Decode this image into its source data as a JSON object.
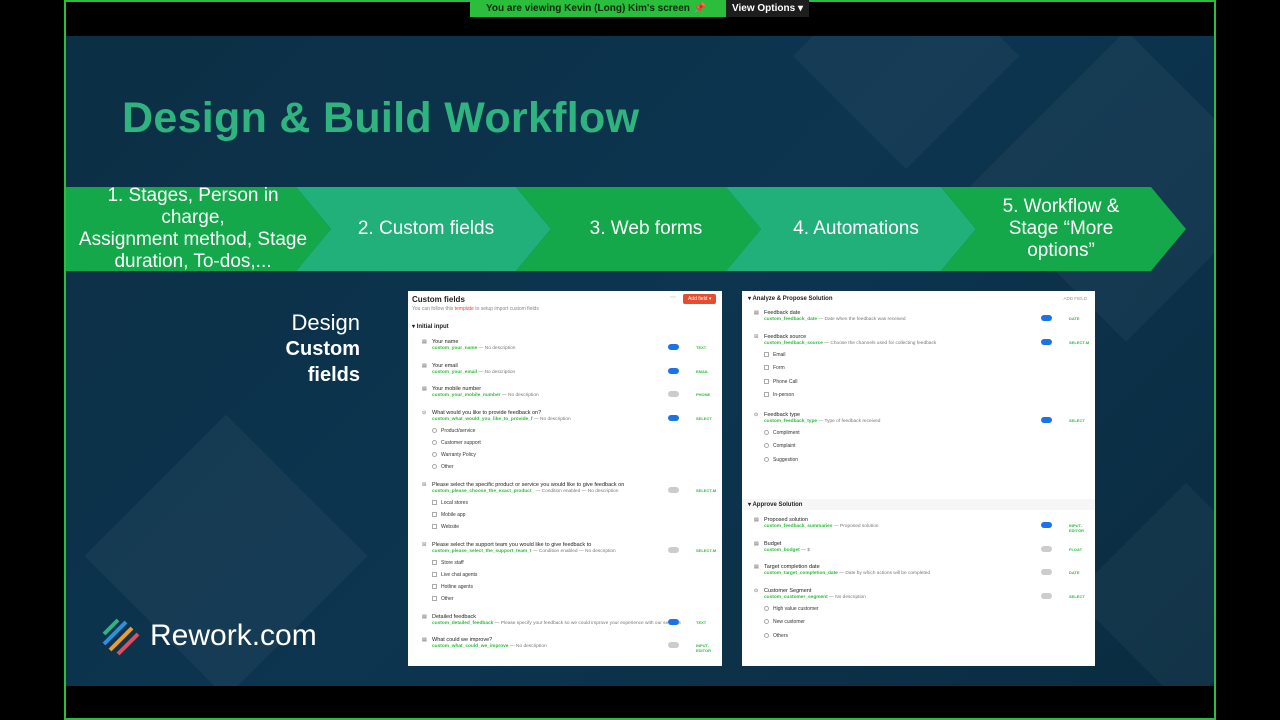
{
  "share_bar": {
    "viewing_text": "You are viewing  Kevin (Long) Kim's screen",
    "view_options": "View Options"
  },
  "slide": {
    "title": "Design & Build Workflow",
    "steps": [
      {
        "label": "1. Stages, Person in charge, Assignment method, Stage duration, To-dos,...",
        "lines": [
          "1. Stages, Person in charge,",
          "Assignment method, Stage",
          "duration, To-dos,..."
        ],
        "color": "#14a84a"
      },
      {
        "label": "2. Custom fields",
        "lines": [
          "2. Custom fields"
        ],
        "color": "#22b07a"
      },
      {
        "label": "3. Web forms",
        "lines": [
          "3. Web forms"
        ],
        "color": "#14a84a"
      },
      {
        "label": "4. Automations",
        "lines": [
          "4. Automations"
        ],
        "color": "#22b07a"
      },
      {
        "label": "5. Workflow & Stage “More options”",
        "lines": [
          "5. Workflow &",
          "Stage “More",
          "options”"
        ],
        "color": "#14a84a"
      }
    ],
    "design_label": {
      "line1": "Design",
      "line2": "Custom fields"
    },
    "logo_text": "Rework.com",
    "colors": {
      "title": "#2fb47f",
      "border": "#2bbd3c",
      "bg": "#0b2f44"
    }
  },
  "left_panel": {
    "title": "Custom fields",
    "hint_prefix": "You can follow this",
    "hint_link": "template",
    "hint_suffix": "to setup import custom fields",
    "add_field": "Add field",
    "section": "Initial input",
    "fields": [
      {
        "name": "Your name",
        "key": "custom_your_name",
        "desc": "— No description",
        "toggle": true,
        "type": "TEXT",
        "options": []
      },
      {
        "name": "Your email",
        "key": "custom_your_email",
        "desc": "— No description",
        "toggle": true,
        "type": "EMAIL",
        "options": []
      },
      {
        "name": "Your mobile number",
        "key": "custom_your_mobile_number",
        "desc": "— No description",
        "toggle": false,
        "type": "PHONE",
        "options": []
      },
      {
        "name": "What would you like to provide feedback on?",
        "key": "custom_what_would_you_like_to_provide_f",
        "desc": "— No description",
        "toggle": true,
        "type": "SELECT",
        "options": [
          "Product/service",
          "Customer support",
          "Warranty Policy",
          "Other"
        ]
      },
      {
        "name": "Please select the specific product or service you would like to give feedback on",
        "key": "custom_please_choose_the_exact_product_",
        "desc": "— Condition enabled — No description",
        "toggle": false,
        "type": "SELECT-M",
        "options": [
          "Local stores",
          "Mobile app",
          "Website"
        ]
      },
      {
        "name": "Please select the support team you would like to give feedback to",
        "key": "custom_please_select_the_support_team_t",
        "desc": "— Condition enabled — No description",
        "toggle": false,
        "type": "SELECT-M",
        "options": [
          "Store staff",
          "Live chat agents",
          "Hotline agents",
          "Other"
        ]
      },
      {
        "name": "Detailed feedback",
        "key": "custom_detailed_feedback",
        "desc": "— Please specify your feedback so we could improve your experience with our services",
        "toggle": true,
        "type": "TEXT",
        "options": []
      },
      {
        "name": "What could we improve?",
        "key": "custom_what_could_we_improve",
        "desc": "— No description",
        "toggle": false,
        "type": "INPUT-EDITOR",
        "options": []
      }
    ]
  },
  "right_panel": {
    "section1": "Analyze & Propose Solution",
    "add_field": "ADD FIELD",
    "fields1": [
      {
        "name": "Feedback date",
        "key": "custom_feedback_date",
        "desc": "— Date when the feedback was received",
        "toggle": true,
        "type": "DATE",
        "options": []
      },
      {
        "name": "Feedback source",
        "key": "custom_feedback_source",
        "desc": "— Choose the channels used for collecting feedback",
        "toggle": true,
        "type": "SELECT-M",
        "options": [
          "Email",
          "Form",
          "Phone Call",
          "In-person"
        ]
      },
      {
        "name": "Feedback type",
        "key": "custom_feedback_type",
        "desc": "— Type of feedback received",
        "toggle": true,
        "type": "SELECT",
        "options": [
          "Compliment",
          "Complaint",
          "Suggestion"
        ]
      }
    ],
    "section2": "Approve Solution",
    "fields2": [
      {
        "name": "Proposed solution",
        "key": "custom_feedback_summaries",
        "desc": "— Proposed solution",
        "toggle": true,
        "type": "INPUT-EDITOR",
        "options": []
      },
      {
        "name": "Budget",
        "key": "custom_budget",
        "desc": "— $",
        "toggle": false,
        "type": "FLOAT",
        "options": []
      },
      {
        "name": "Target completion date",
        "key": "custom_target_completion_date",
        "desc": "— Date by which actions will be completed",
        "toggle": false,
        "type": "DATE",
        "options": []
      },
      {
        "name": "Customer Segment",
        "key": "custom_customer_segment",
        "desc": "— No description",
        "toggle": false,
        "type": "SELECT",
        "options": [
          "High value customer",
          "New customer",
          "Others"
        ]
      }
    ]
  }
}
